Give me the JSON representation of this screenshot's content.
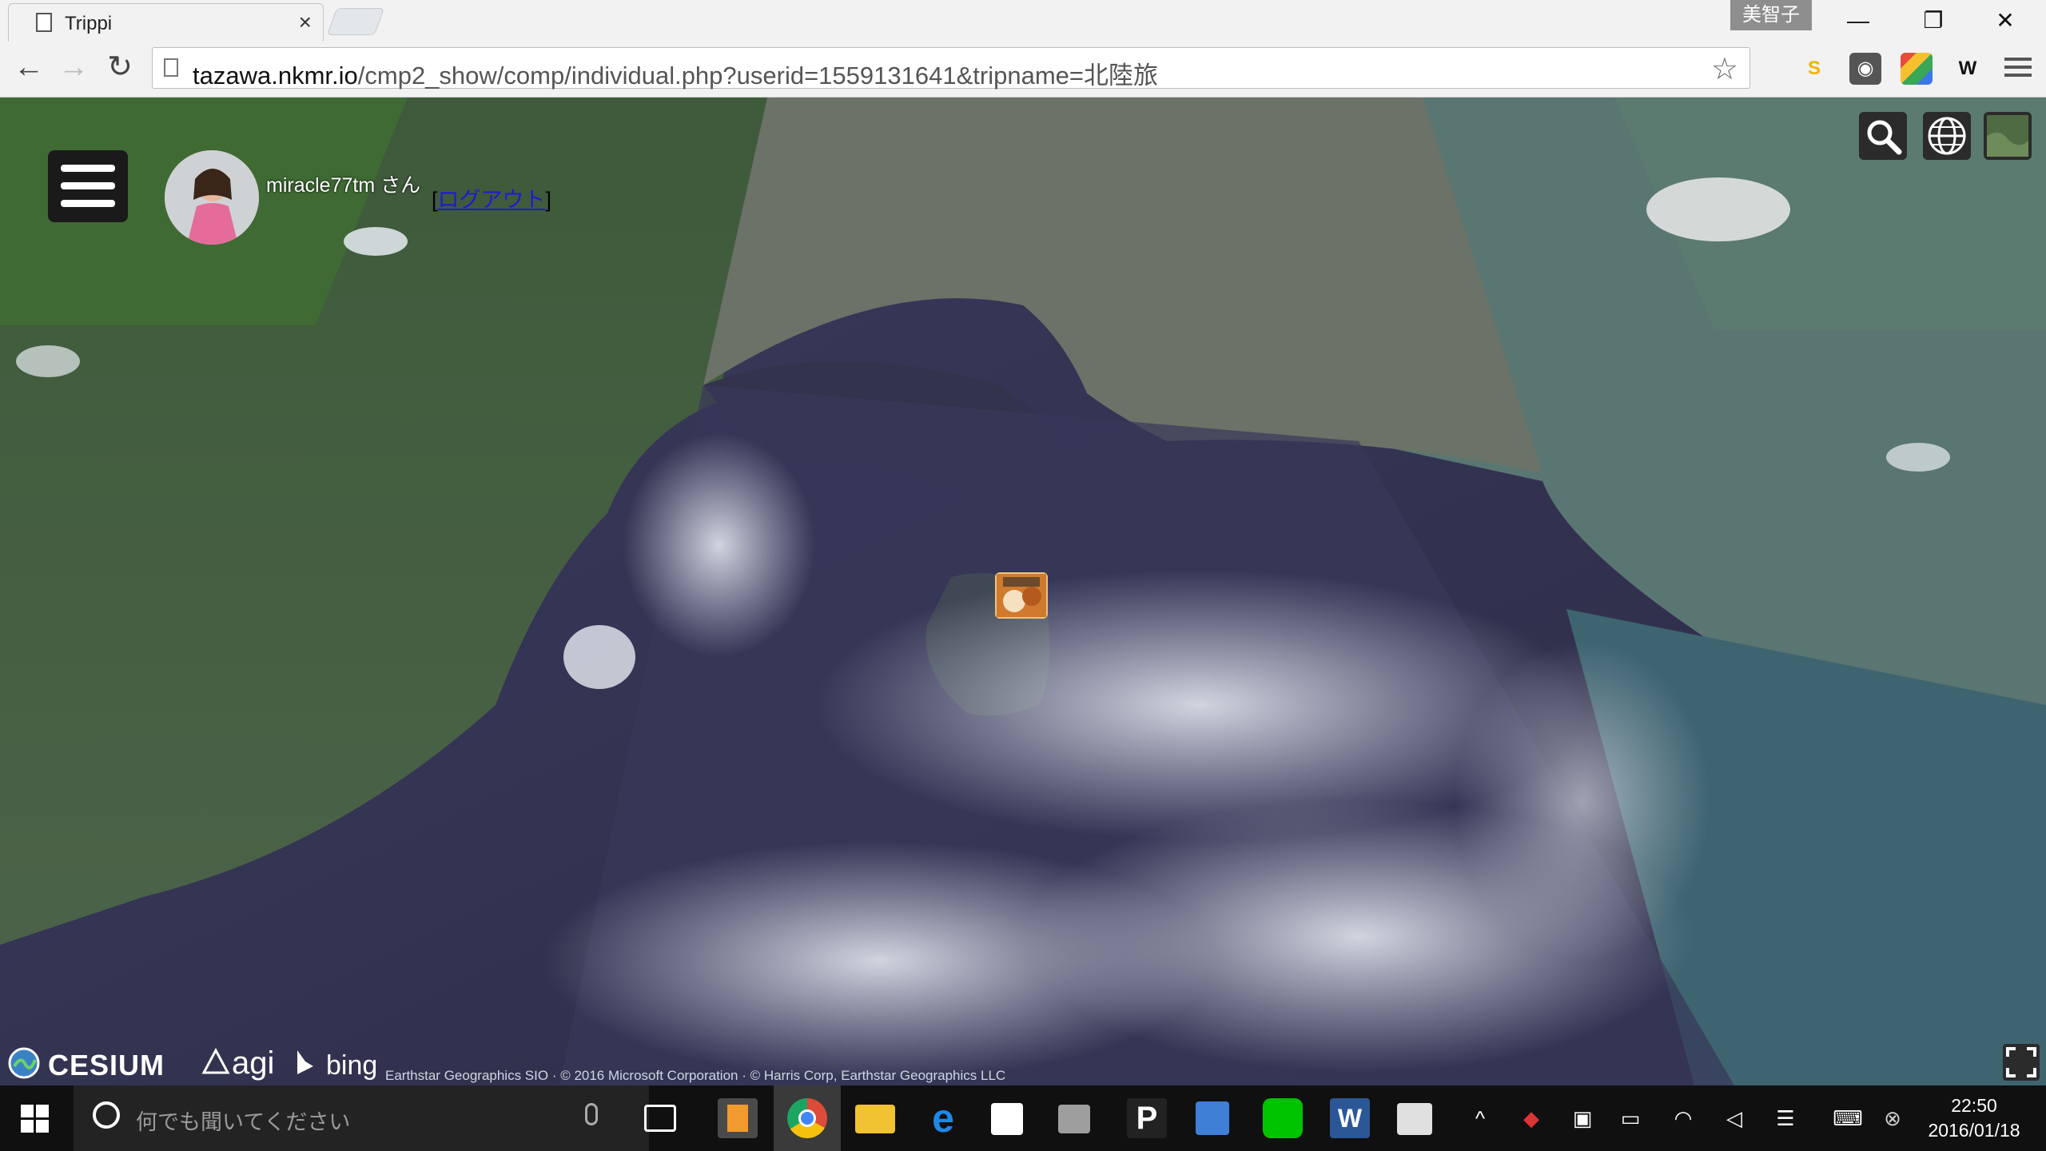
{
  "browser": {
    "tab_title": "Trippi",
    "tab_close": "×",
    "user_badge": "美智子",
    "window_buttons": {
      "minimize": "—",
      "restore": "❐",
      "close": "✕"
    },
    "nav": {
      "back": "←",
      "forward": "→",
      "reload": "↻"
    },
    "url_host": "tazawa.nkmr.io",
    "url_path": "/cmp2_show/comp/individual.php?userid=1559131641&tripname=北陸旅",
    "star": "☆",
    "extensions": [
      {
        "name": "s-extension-icon",
        "label": "S",
        "color": "#f3b300"
      },
      {
        "name": "mask-extension-icon",
        "label": "◉",
        "color": "#555555"
      },
      {
        "name": "color-extension-icon",
        "label": "",
        "color": "#e84a3c"
      },
      {
        "name": "w-extension-icon",
        "label": "W",
        "color": "#111111"
      }
    ]
  },
  "app": {
    "username": "miracle77tm さん",
    "logout_open": "[",
    "logout_label": "ログアウト",
    "logout_close": "]",
    "map_buttons": [
      "search-icon",
      "globe-icon",
      "imagery-picker-icon"
    ]
  },
  "map_credits": {
    "cesium": "CESIUM",
    "agi": "agi",
    "bing": "bing",
    "text": "Earthstar Geographics SIO · © 2016 Microsoft Corporation · © Harris Corp, Earthstar Geographics LLC"
  },
  "taskbar": {
    "search_placeholder": "何でも聞いてください",
    "apps": [
      {
        "name": "task-view-icon",
        "color": "#101010"
      },
      {
        "name": "sublime-text-icon",
        "color": "#4a4a4a"
      },
      {
        "name": "chrome-icon",
        "color": "#dd4b39"
      },
      {
        "name": "file-explorer-icon",
        "color": "#f1c232"
      },
      {
        "name": "edge-icon",
        "color": "#1e88e5"
      },
      {
        "name": "store-icon",
        "color": "#ffffff"
      },
      {
        "name": "snipping-tool-icon",
        "color": "#9e9e9e"
      },
      {
        "name": "p-app-icon",
        "color": "#222222"
      },
      {
        "name": "network-app-icon",
        "color": "#3f7fd6"
      },
      {
        "name": "line-icon",
        "color": "#00c300"
      },
      {
        "name": "word-icon",
        "color": "#2b5797"
      },
      {
        "name": "photos-icon",
        "color": "#e0e0e0"
      }
    ],
    "time": "22:50",
    "date": "2016/01/18"
  }
}
